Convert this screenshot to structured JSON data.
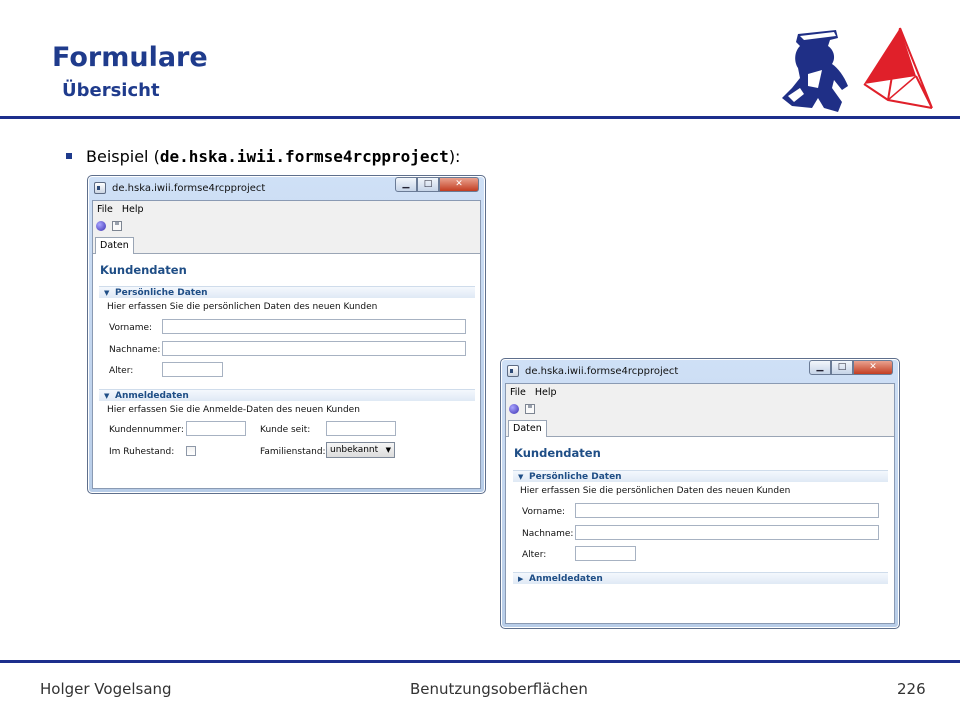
{
  "slide": {
    "title": "Formulare",
    "subtitle": "Übersicht",
    "bullet_prefix": "Beispiel (",
    "bullet_code": "de.hska.iwii.formse4rcpproject",
    "bullet_suffix": "):"
  },
  "footer": {
    "author": "Holger Vogelsang",
    "course": "Benutzungsoberflächen",
    "page": "226"
  },
  "window1": {
    "title": "de.hska.iwii.formse4rcpproject",
    "menu": [
      "File",
      "Help"
    ],
    "tab": "Daten",
    "form_title": "Kundendaten",
    "section1": {
      "title": "Persönliche Daten",
      "description": "Hier erfassen Sie die persönlichen Daten des neuen Kunden",
      "labels": [
        "Vorname:",
        "Nachname:",
        "Alter:"
      ],
      "values": [
        "",
        "",
        ""
      ]
    },
    "section2": {
      "title": "Anmeldedaten",
      "description": "Hier erfassen Sie die Anmelde-Daten des neuen Kunden",
      "kundennummer_label": "Kundennummer:",
      "kunde_seit_label": "Kunde seit:",
      "ruhestand_label": "Im Ruhestand:",
      "familienstand_label": "Familienstand:",
      "familienstand_value": "unbekannt"
    }
  },
  "window2": {
    "title": "de.hska.iwii.formse4rcpproject",
    "menu": [
      "File",
      "Help"
    ],
    "tab": "Daten",
    "form_title": "Kundendaten",
    "section1": {
      "title": "Persönliche Daten",
      "description": "Hier erfassen Sie die persönlichen Daten des neuen Kunden",
      "labels": [
        "Vorname:",
        "Nachname:",
        "Alter:"
      ]
    },
    "section2": {
      "title": "Anmeldedaten",
      "collapsed": true
    }
  },
  "icons": {
    "window_minimize": "minimize-icon",
    "window_maximize": "maximize-icon",
    "window_close": "close-icon",
    "run": "run-icon",
    "save": "save-icon",
    "expand": "triangle-down-icon",
    "collapsed": "triangle-right-icon"
  },
  "colors": {
    "accent": "#1f3b8c",
    "section_title": "#1f4e86",
    "logo_red": "#e0202a"
  }
}
